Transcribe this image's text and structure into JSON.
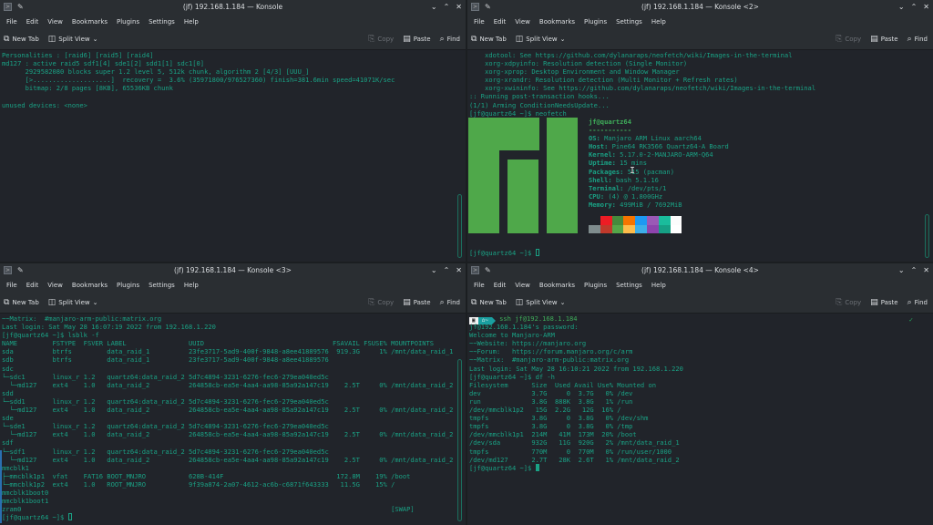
{
  "menu": [
    "File",
    "Edit",
    "View",
    "Bookmarks",
    "Plugins",
    "Settings",
    "Help"
  ],
  "toolbar": {
    "new_tab": "New Tab",
    "split_view": "Split View",
    "copy": "Copy",
    "paste": "Paste",
    "find": "Find"
  },
  "windows": [
    {
      "title": "(jf) 192.168.1.184 — Konsole",
      "lines": [
        "Personalities : [raid6] [raid5] [raid4]",
        "md127 : active raid5 sdf1[4] sde1[2] sdd1[1] sdc1[0]",
        "      2929582080 blocks super 1.2 level 5, 512k chunk, algorithm 2 [4/3] [UUU_]",
        "      [>....................]  recovery =  3.6% (35971800/976527360) finish=381.6min speed=41071K/sec",
        "      bitmap: 2/8 pages [8KB], 65536KB chunk",
        "",
        "unused devices: <none>"
      ]
    },
    {
      "title": "(jf) 192.168.1.184 — Konsole <2>",
      "lines": [
        "    xdotool: See https://github.com/dylanaraps/neofetch/wiki/Images-in-the-terminal",
        "    xorg-xdpyinfo: Resolution detection (Single Monitor)",
        "    xorg-xprop: Desktop Environment and Window Manager",
        "    xorg-xrandr: Resolution detection (Multi Monitor + Refresh rates)",
        "    xorg-xwininfo: See https://github.com/dylanaraps/neofetch/wiki/Images-in-the-terminal",
        ":: Running post-transaction hooks...",
        "(1/1) Arming ConditionNeedsUpdate...",
        "[jf@quartz64 ~]$ neofetch"
      ],
      "neofetch": {
        "user_host": "jf@quartz64",
        "separator": "-----------",
        "info": [
          {
            "key": "OS",
            "value": " Manjaro ARM Linux aarch64"
          },
          {
            "key": "Host",
            "value": " Pine64 RK3566 Quartz64-A Board"
          },
          {
            "key": "Kernel",
            "value": " 5.17.0-2-MANJARO-ARM-Q64"
          },
          {
            "key": "Uptime",
            "value": " 15 mins"
          },
          {
            "key": "Packages",
            "value": " 515 (pacman)"
          },
          {
            "key": "Shell",
            "value": " bash 5.1.16"
          },
          {
            "key": "Terminal",
            "value": " /dev/pts/1"
          },
          {
            "key": "CPU",
            "value": " (4) @ 1.800GHz"
          },
          {
            "key": "Memory",
            "value": " 499MiB / 7692MiB"
          }
        ],
        "palette_top": [
          "#21242a",
          "#ed1c24",
          "#468a3c",
          "#f67400",
          "#1d99f3",
          "#9b59b6",
          "#1abc9c",
          "#fcfcfc"
        ],
        "palette_bottom": [
          "#7f8c8d",
          "#c0392b",
          "#55a649",
          "#fdbc4b",
          "#3daee9",
          "#8e44ad",
          "#16a085",
          "#ffffff"
        ],
        "logo_color": "#4fa84a"
      },
      "prompt": "[jf@quartz64 ~]$ "
    },
    {
      "title": "(jf) 192.168.1.184 — Konsole <3>",
      "lines": [
        "~~Matrix:  #manjaro-arm-public:matrix.org",
        "Last login: Sat May 28 16:07:19 2022 from 192.168.1.220",
        "[jf@quartz64 ~]$ lsblk -f",
        "NAME         FSTYPE  FSVER LABEL                UUID                                 FSAVAIL FSUSE% MOUNTPOINTS",
        "sda          btrfs         data_raid_1          23fe3717-5ad9-400f-9848-a8ee41889576  919.3G     1% /mnt/data_raid_1",
        "sdb          btrfs         data_raid_1          23fe3717-5ad9-400f-9848-a8ee41889576",
        "sdc",
        "└─sdc1       linux_r 1.2   quartz64:data_raid_2 5d7c4894-3231-6276-fec6-279ea040ed5c",
        "  └─md127    ext4    1.0   data_raid_2          264858cb-ea5e-4aa4-aa98-85a92a147c19    2.5T     0% /mnt/data_raid_2",
        "sdd",
        "└─sdd1       linux_r 1.2   quartz64:data_raid_2 5d7c4894-3231-6276-fec6-279ea040ed5c",
        "  └─md127    ext4    1.0   data_raid_2          264858cb-ea5e-4aa4-aa98-85a92a147c19    2.5T     0% /mnt/data_raid_2",
        "sde",
        "└─sde1       linux_r 1.2   quartz64:data_raid_2 5d7c4894-3231-6276-fec6-279ea040ed5c",
        "  └─md127    ext4    1.0   data_raid_2          264858cb-ea5e-4aa4-aa98-85a92a147c19    2.5T     0% /mnt/data_raid_2",
        "sdf",
        "└─sdf1       linux_r 1.2   quartz64:data_raid_2 5d7c4894-3231-6276-fec6-279ea040ed5c",
        "  └─md127    ext4    1.0   data_raid_2          264858cb-ea5e-4aa4-aa98-85a92a147c19    2.5T     0% /mnt/data_raid_2",
        "mmcblk1",
        "├─mmcblk1p1  vfat    FAT16 BOOT_MNJRO           628B-414F                             172.8M    19% /boot",
        "└─mmcblk1p2  ext4    1.0   ROOT_MNJRO           9f39a874-2a07-4612-ac6b-c6871f643333   11.5G    15% /",
        "mmcblk1boot0",
        "mmcblk1boot1",
        "zram0                                                                                               [SWAP]"
      ],
      "prompt": "[jf@quartz64 ~]$ "
    },
    {
      "title": "(jf) 192.168.1.184 — Konsole <4>",
      "ps_home": "~",
      "ps_command": " ssh jf@192.168.1.184",
      "status_check": "✓",
      "lines": [
        "jf@192.168.1.184's password:",
        "Welcome to Manjaro-ARM",
        "~~Website: https://manjaro.org",
        "~~Forum:   https://forum.manjaro.org/c/arm",
        "~~Matrix:  #manjaro-arm-public:matrix.org",
        "Last login: Sat May 28 16:10:21 2022 from 192.168.1.220",
        "[jf@quartz64 ~]$ df -h",
        "Filesystem      Size  Used Avail Use% Mounted on",
        "dev             3.7G     0  3.7G   0% /dev",
        "run             3.8G  888K  3.8G   1% /run",
        "/dev/mmcblk1p2   15G  2.2G   12G  16% /",
        "tmpfs           3.8G     0  3.8G   0% /dev/shm",
        "tmpfs           3.8G     0  3.8G   0% /tmp",
        "/dev/mmcblk1p1  214M   41M  173M  20% /boot",
        "/dev/sda        932G   11G  920G   2% /mnt/data_raid_1",
        "tmpfs           770M     0  770M   0% /run/user/1000",
        "/dev/md127      2.7T   28K  2.6T   1% /mnt/data_raid_2"
      ],
      "prompt": "[jf@quartz64 ~]$ "
    }
  ]
}
